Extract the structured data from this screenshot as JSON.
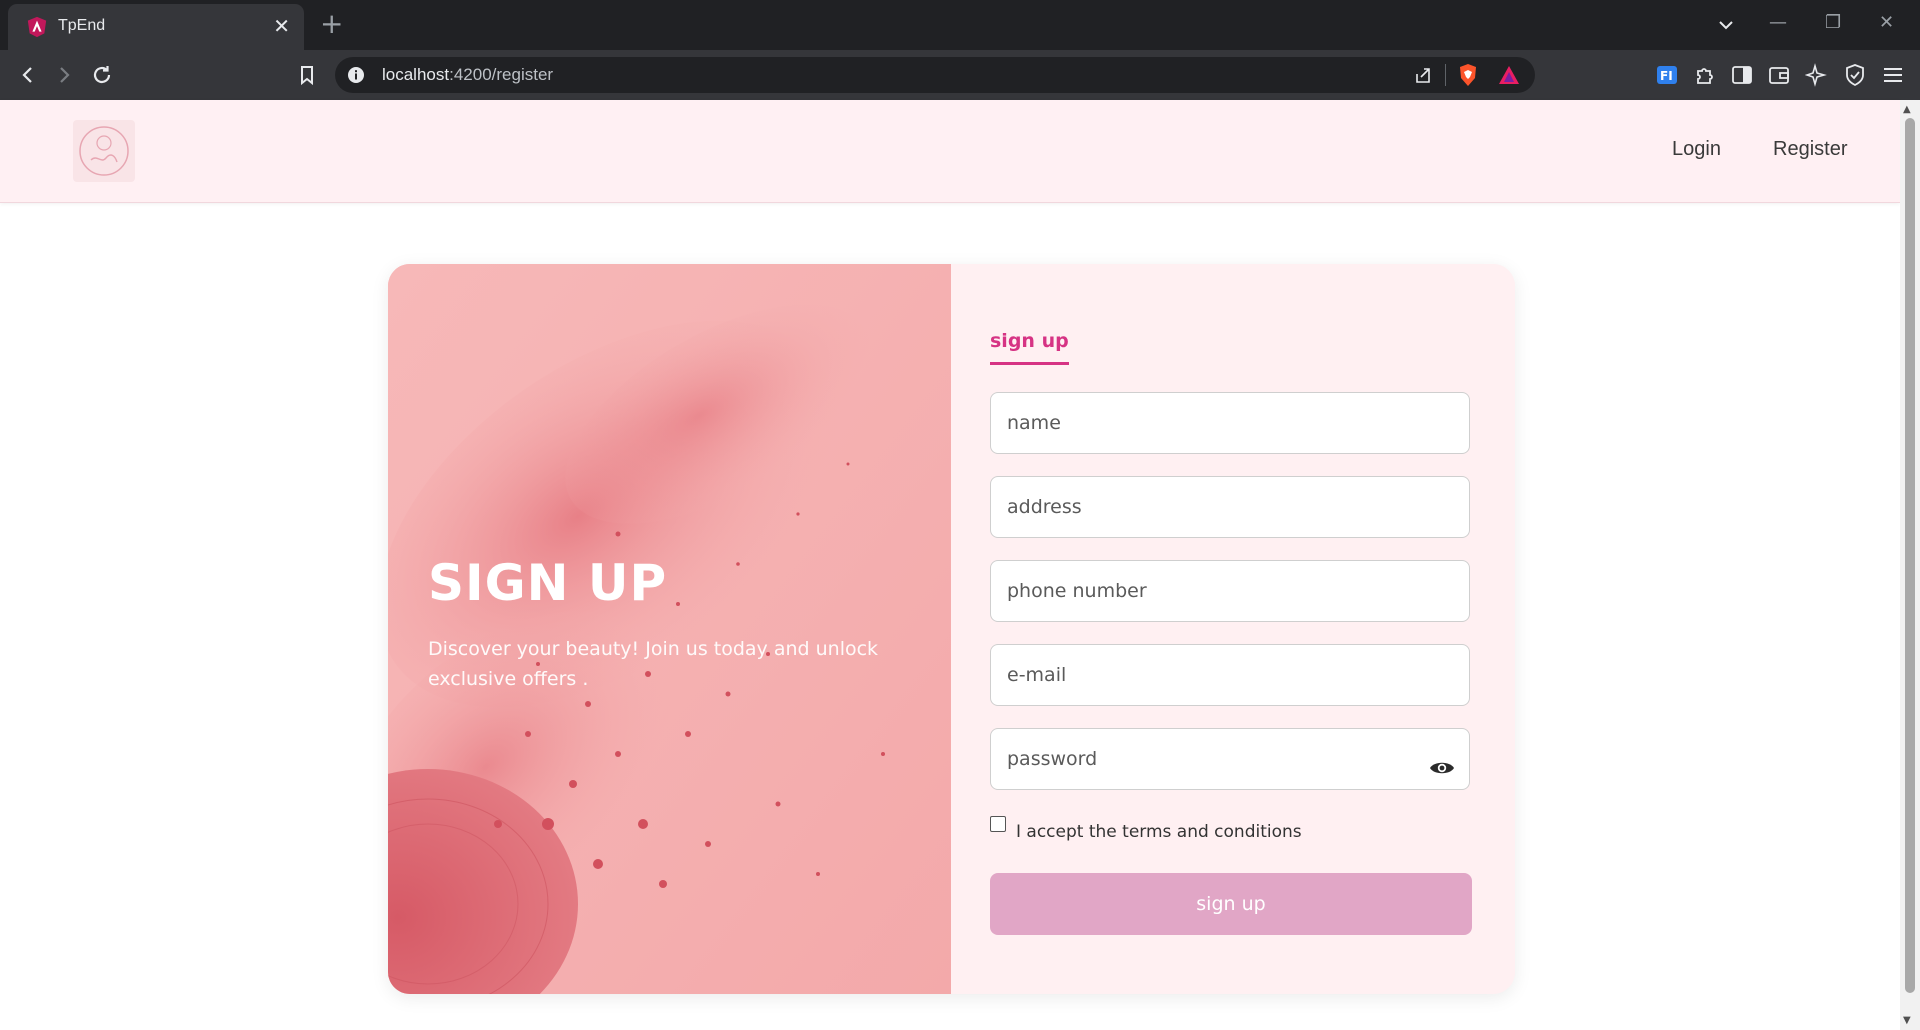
{
  "browser": {
    "tab_title": "TpEnd",
    "tab_close": "✕",
    "new_tab": "+",
    "url_host": "localhost",
    "url_path": ":4200/register",
    "window_controls": {
      "minimize": "—",
      "restore": "❐",
      "close": "✕"
    }
  },
  "navbar": {
    "links": [
      "Login",
      "Register"
    ]
  },
  "hero": {
    "title": "SIGN UP",
    "subtitle": "Discover your beauty! Join us today and unlock exclusive offers ."
  },
  "form": {
    "tab_label": "sign up",
    "fields": [
      {
        "placeholder": "name",
        "value": ""
      },
      {
        "placeholder": "address",
        "value": ""
      },
      {
        "placeholder": "phone number",
        "value": ""
      },
      {
        "placeholder": "e-mail",
        "value": ""
      },
      {
        "placeholder": "password",
        "value": ""
      }
    ],
    "terms_label": "I accept the terms and conditions",
    "terms_checked": false,
    "submit_label": "sign up"
  },
  "colors": {
    "accent": "#d63384",
    "button": "#e1a6c6",
    "navbar_bg": "#fff0f3",
    "hero_bg": "#f6b3b3"
  }
}
